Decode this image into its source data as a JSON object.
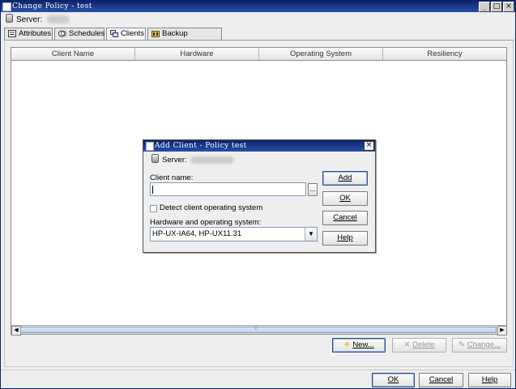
{
  "window": {
    "title": "Change Policy - test",
    "minimize": "_",
    "maximize": "□",
    "close": "×"
  },
  "server": {
    "label": "Server:"
  },
  "tabs": [
    {
      "label": "Attributes"
    },
    {
      "label": "Schedules"
    },
    {
      "label": "Clients"
    },
    {
      "label": "Backup Selections"
    }
  ],
  "table": {
    "columns": [
      "Client Name",
      "Hardware",
      "Operating System",
      "Resiliency"
    ],
    "scroll_left": "◀",
    "scroll_right": "▶",
    "thumb_grip": "⦀"
  },
  "panel_buttons": {
    "new_label": "New...",
    "delete_label": "Delete",
    "change_label": "Change..."
  },
  "footer_buttons": {
    "ok_label": "OK",
    "cancel_label": "Cancel",
    "help_label": "Help"
  },
  "dialog": {
    "title": "Add Client - Policy test",
    "close": "×",
    "server_label": "Server:",
    "client_name_label": "Client name:",
    "client_name_value": "",
    "browse_label": "...",
    "detect_label": "Detect client operating system",
    "hw_os_label": "Hardware and operating system:",
    "hw_os_value": "HP-UX-IA64, HP-UX11.31",
    "combo_arrow": "▼",
    "buttons": {
      "add_label": "Add",
      "ok_label": "OK",
      "cancel_label": "Cancel",
      "help_label": "Help"
    }
  },
  "colors": {
    "titlebar": "#0a246a",
    "window_bg": "#eeeeee",
    "focus_border": "#2b4e8c"
  }
}
